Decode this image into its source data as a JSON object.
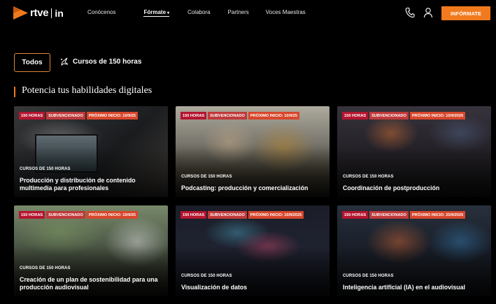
{
  "header": {
    "logo_text": "rtve",
    "logo_suffix": "in",
    "nav": [
      {
        "label": "Conócenos"
      },
      {
        "label": "Fórmate"
      },
      {
        "label": "Colabora"
      },
      {
        "label": "Partners"
      },
      {
        "label": "Voces Maestras"
      }
    ],
    "cta_label": "INFÓRMATE",
    "accent": "#f07a1d"
  },
  "filters": {
    "all_label": "Todos",
    "course_label": "Cursos de 150 horas"
  },
  "section": {
    "title": "Potencia tus habilidades digitales"
  },
  "cards": [
    {
      "badges": [
        "150 HORAS",
        "SUBVENCIONADO",
        "PRÓXIMO INICIO: 10/9/25"
      ],
      "category": "CURSOS DE 150 HORAS",
      "title": "Producción y distribución de contenido multimedia para profesionales"
    },
    {
      "badges": [
        "150 HORAS",
        "SUBVENCIONADO",
        "PRÓXIMO INICIO: 10/9/25"
      ],
      "category": "CURSOS DE 150 HORAS",
      "title": "Podcasting: producción y comercialización"
    },
    {
      "badges": [
        "150 HORAS",
        "SUBVENCIONADO",
        "PRÓXIMO INICIO: 10/9/2025"
      ],
      "category": "CURSOS DE 150 HORAS",
      "title": "Coordinación de postproducción"
    },
    {
      "badges": [
        "150 HORAS",
        "SUBVENCIONADO",
        "PRÓXIMO INICIO: 10/9/25"
      ],
      "category": "CURSOS DE 150 HORAS",
      "title": "Creación de un plan de sostenibilidad para una producción audiovisual"
    },
    {
      "badges": [
        "150 HORAS",
        "SUBVENCIONADO",
        "PRÓXIMO INICIO: 10/9/2025"
      ],
      "category": "CURSOS DE 150 HORAS",
      "title": "Visualización de datos"
    },
    {
      "badges": [
        "150 HORAS",
        "SUBVENCIONADO",
        "PRÓXIMO INICIO: 25/9/2025"
      ],
      "category": "CURSOS DE 150 HORAS",
      "title": "Inteligencia artificial (IA) en el audiovisual"
    }
  ]
}
